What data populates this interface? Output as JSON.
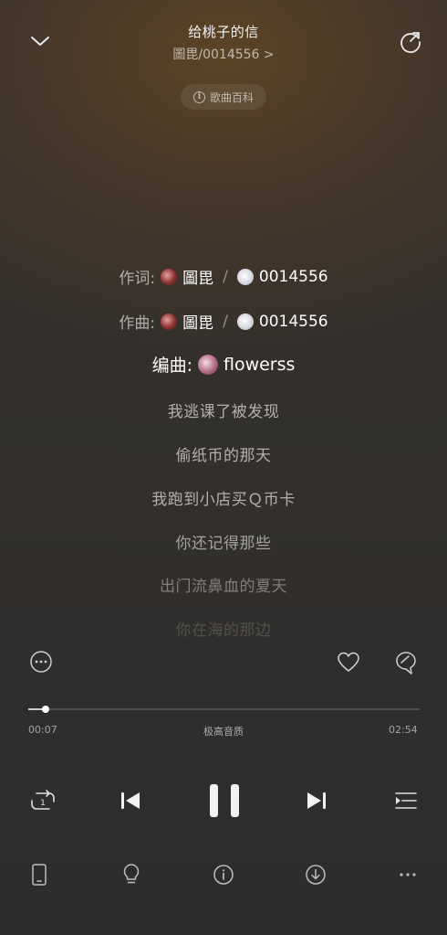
{
  "header": {
    "song_title": "给桃子的信",
    "artist_line": "圖毘/0014556 >",
    "wiki_label": "歌曲百科"
  },
  "credits": [
    {
      "label": "作词:",
      "names": [
        "圖毘",
        "0014556"
      ]
    },
    {
      "label": "作曲:",
      "names": [
        "圖毘",
        "0014556"
      ]
    },
    {
      "label": "编曲:",
      "names": [
        "flowerss"
      ]
    }
  ],
  "lyrics": [
    "我逃课了被发现",
    "偷纸币的那天",
    "我跑到小店买Ｑ币卡",
    "你还记得那些",
    "出门流鼻血的夏天",
    "你在海的那边"
  ],
  "player": {
    "current_time": "00:07",
    "total_time": "02:54",
    "quality_label": "极高音质",
    "progress": 0.045
  },
  "icons": {
    "collapse": "chevron-down-icon",
    "share": "share-icon",
    "more": "more-circle-icon",
    "like": "heart-icon",
    "comment": "comment-icon",
    "repeat": "repeat-one-icon",
    "prev": "previous-icon",
    "pause": "pause-icon",
    "next": "next-icon",
    "playlist": "playlist-icon",
    "device": "phone-icon",
    "tips": "bulb-icon",
    "info": "info-icon",
    "download": "download-icon",
    "more_bottom": "more-dots-icon"
  }
}
